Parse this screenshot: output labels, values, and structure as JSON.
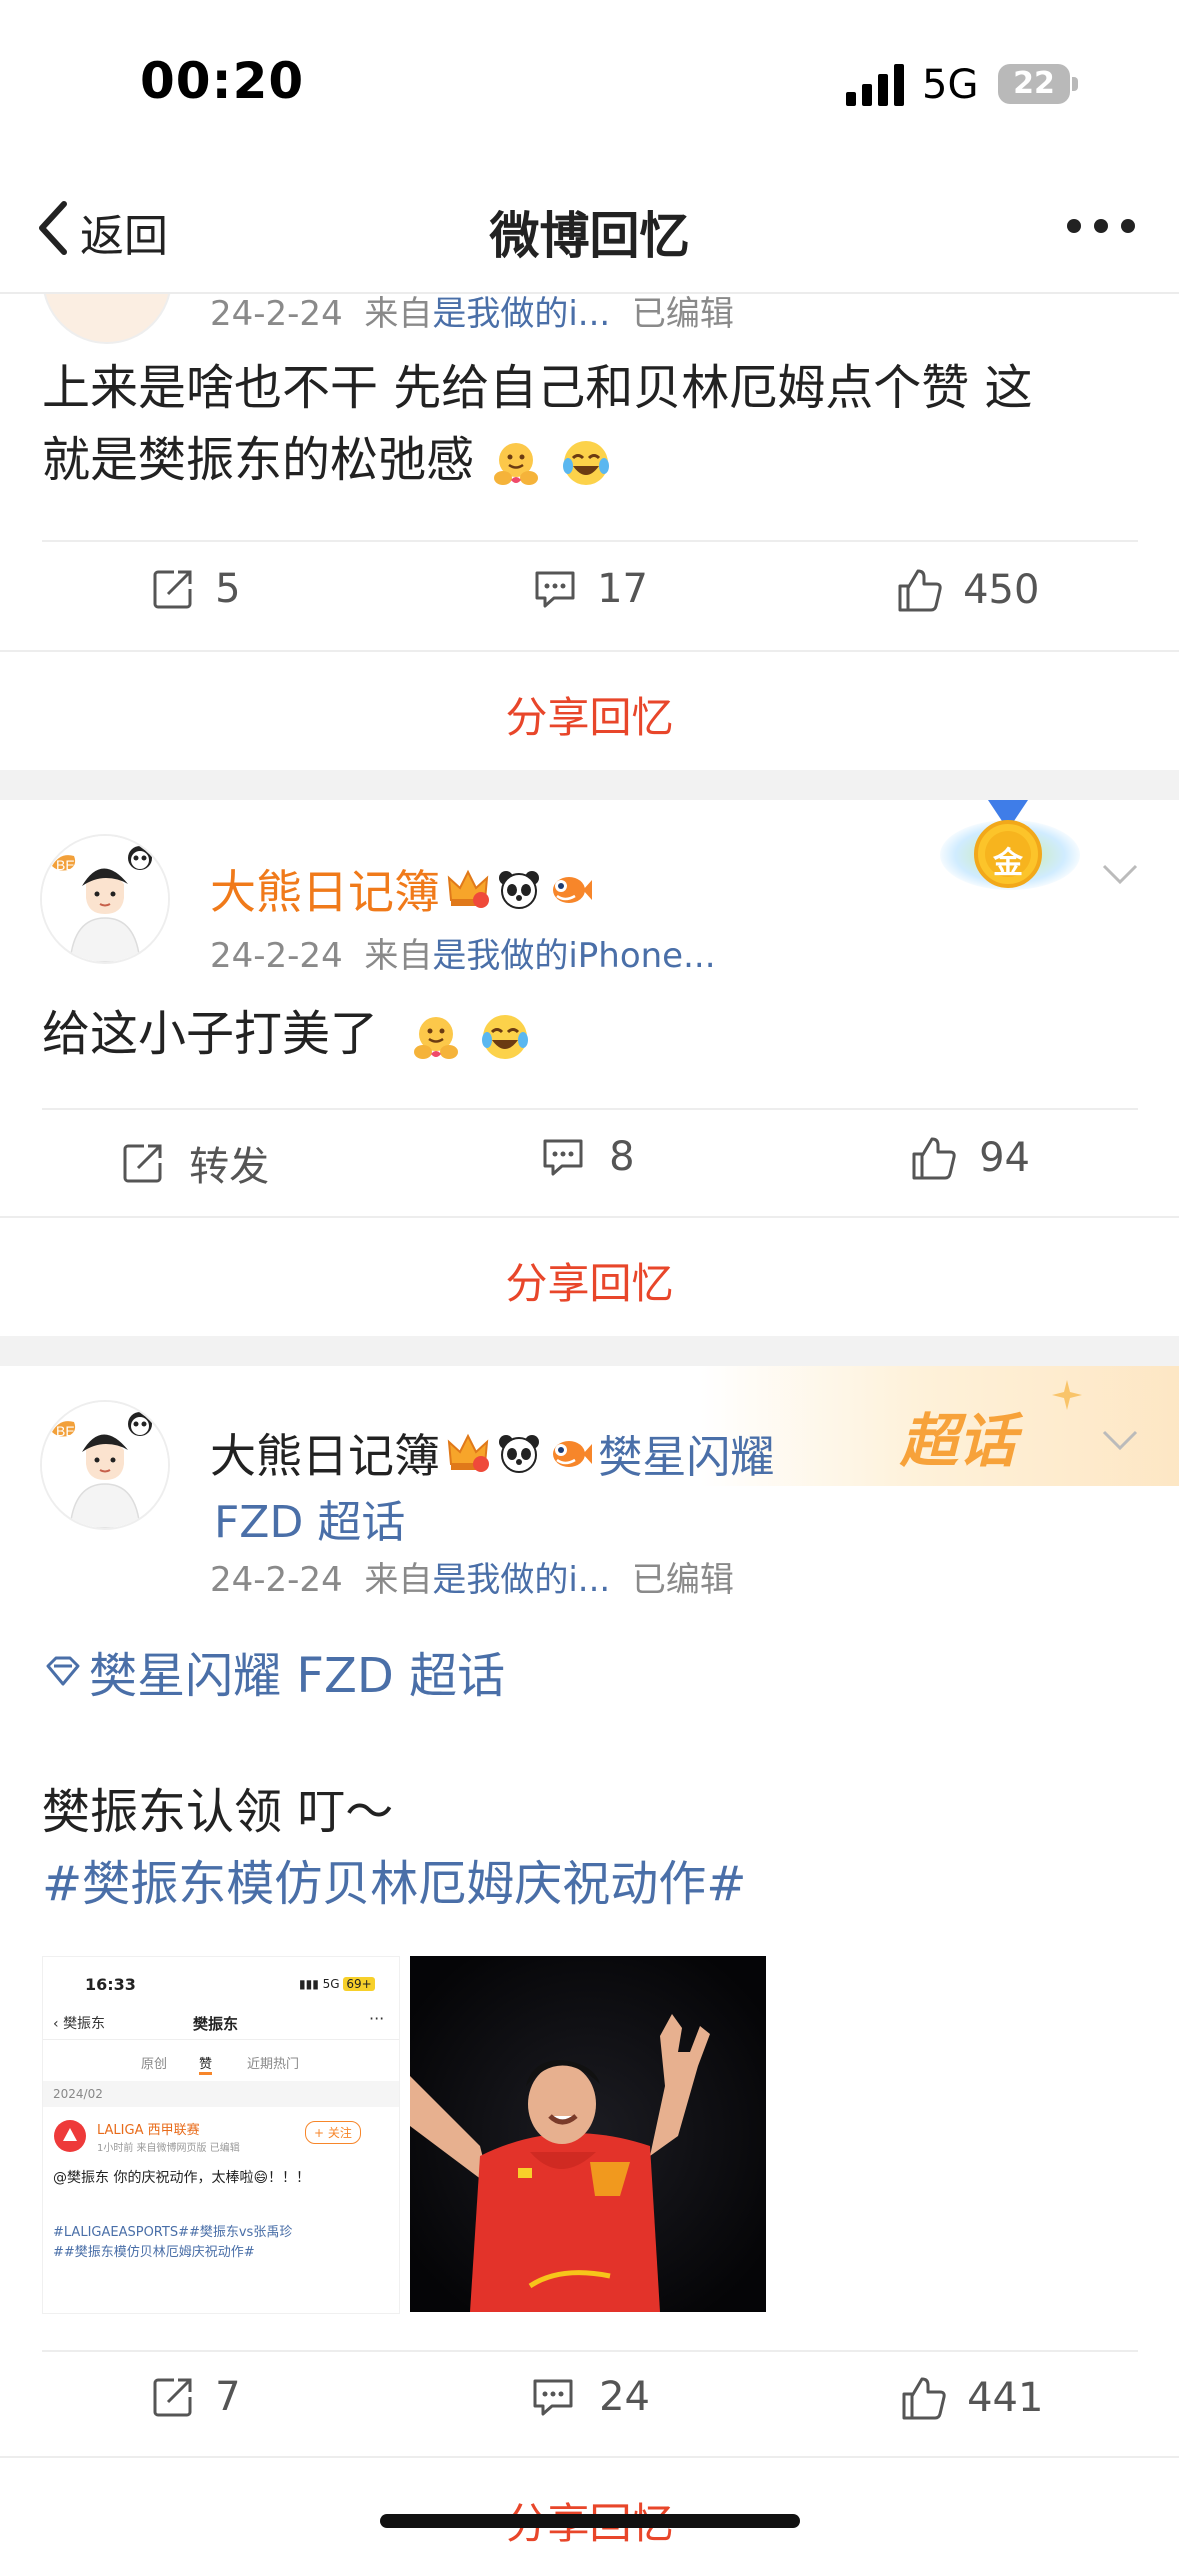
{
  "status_bar": {
    "time": "00:20",
    "network": "5G",
    "battery": "22"
  },
  "nav": {
    "back_label": "返回",
    "title": "微博回忆"
  },
  "post1": {
    "meta_date": "24-2-24",
    "meta_from": "来自",
    "meta_source": "是我做的i...",
    "meta_edited": "已编辑",
    "text_line1": "上来是啥也不干 先给自己和贝林厄姆点个赞 这",
    "text_line2": "就是樊振东的松弛感",
    "repost_count": "5",
    "comment_count": "17",
    "like_count": "450",
    "share_label": "分享回忆"
  },
  "post2": {
    "username": "大熊日记簿",
    "medal_char": "金",
    "meta_date": "24-2-24",
    "meta_from": "来自",
    "meta_source": "是我做的iPhone...",
    "text": "给这小子打美了",
    "repost_label": "转发",
    "comment_count": "8",
    "like_count": "94",
    "share_label": "分享回忆"
  },
  "post3": {
    "username": "大熊日记簿",
    "topic_line1": "樊星闪耀",
    "topic_line2": "FZD 超话",
    "badge_label": "超话",
    "meta_date": "24-2-24",
    "meta_from": "来自",
    "meta_source": "是我做的i...",
    "meta_edited": "已编辑",
    "topic_link": "樊星闪耀 FZD 超话",
    "text_line1": "樊振东认领 叮～",
    "hashtag": "#樊振东模仿贝林厄姆庆祝动作#",
    "repost_count": "7",
    "comment_count": "24",
    "like_count": "441",
    "share_label": "分享回忆"
  },
  "thumb1": {
    "time": "16:33",
    "signal": "5G",
    "battery": "69+",
    "back": "樊振东",
    "title": "樊振东",
    "tabs": [
      "原创",
      "赞",
      "近期热门"
    ],
    "date": "2024/02",
    "account": "LALIGA 西甲联赛",
    "follow": "+ 关注",
    "meta": "1小时前 来自微博网页版 已编辑",
    "text1": "@樊振东 你的庆祝动作，太棒啦😄！！！",
    "text2": "#LALIGAEASPORTS##樊振东vs张禹珍",
    "text3": "##樊振东模仿贝林厄姆庆祝动作#"
  },
  "colors": {
    "accent": "#e8462a",
    "link": "#4a6fa8",
    "vip_name": "#f07a1a"
  }
}
